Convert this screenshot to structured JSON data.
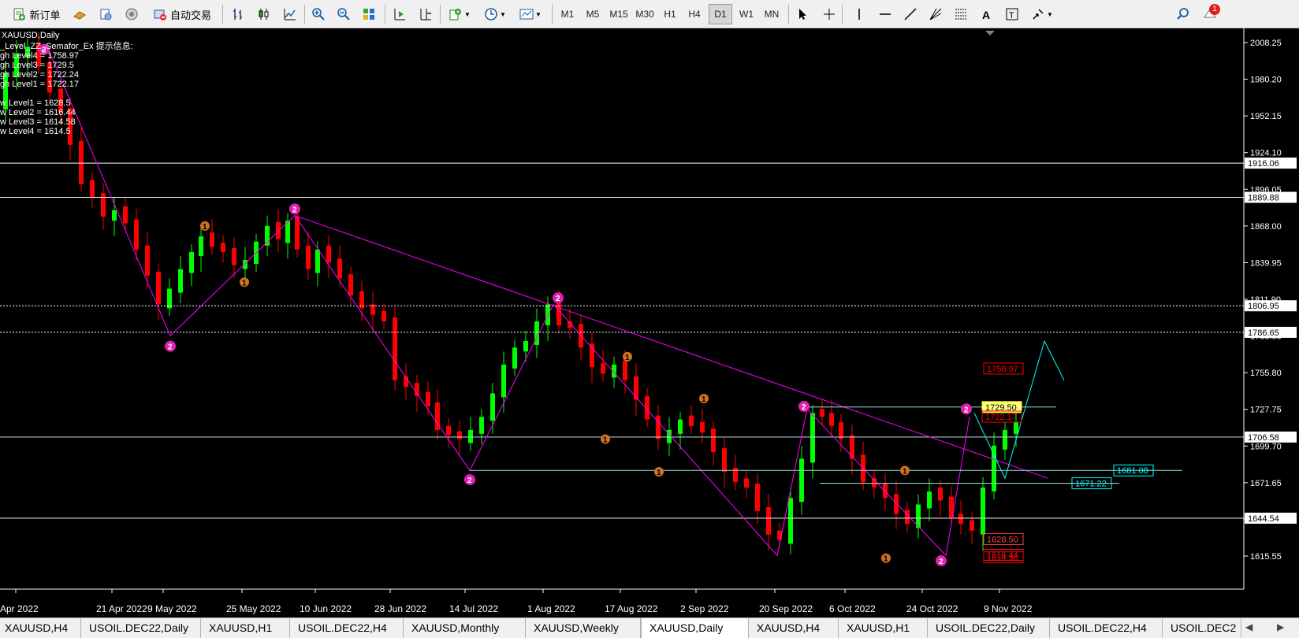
{
  "toolbar": {
    "new_order_label": "新订单",
    "autotrade_label": "自动交易",
    "timeframes": [
      "M1",
      "M5",
      "M15",
      "M30",
      "H1",
      "H4",
      "D1",
      "W1",
      "MN"
    ],
    "active_timeframe": "D1",
    "notification_count": "1",
    "icons": [
      "new-order-icon",
      "market-watch-icon",
      "data-window-icon",
      "navigator-icon",
      "autotrade-icon",
      "bar-chart-icon",
      "candlestick-icon",
      "line-chart-icon",
      "zoom-in-icon",
      "zoom-out-icon",
      "tile-windows-icon",
      "scroll-icon",
      "autoscroll-icon",
      "indicators-icon",
      "periods-icon",
      "templates-icon",
      "cursor-icon",
      "crosshair-icon",
      "vertical-line-icon",
      "horizontal-line-icon",
      "trendline-icon",
      "gann-icon",
      "fibonacci-icon",
      "text-icon",
      "text-label-icon",
      "arrows-icon",
      "search-icon",
      "notification-icon"
    ]
  },
  "chart": {
    "symbol_label": "XAUUSD,Daily",
    "info_lines": [
      "_Level_ZZ_Semafor_Ex 提示信息:",
      "gh Level4 = 1758.97",
      "gh Level3 = 1729.5",
      "gh Level2 = 1722.24",
      "gh Level1 = 1722.17",
      "",
      "w Level1 = 1628.5",
      "w Level2 = 1616.44",
      "w Level3 = 1614.58",
      "w Level4 = 1614.5"
    ],
    "colors": {
      "background": "#000000",
      "bull": "#00ff00",
      "bear": "#ff0000",
      "zigzag": "#ff00ff",
      "forecast": "#00ffff",
      "grid_text": "#ffffff"
    },
    "price_ticks": [
      "2008.25",
      "1980.20",
      "1952.15",
      "1924.10",
      "1896.05",
      "1868.00",
      "1839.95",
      "1811.90",
      "1783.85",
      "1755.80",
      "1727.75",
      "1699.70",
      "1671.65",
      "1643.60",
      "1615.55"
    ],
    "date_ticks": [
      "Apr 2022",
      "21 Apr 2022",
      "9 May 2022",
      "25 May 2022",
      "10 Jun 2022",
      "28 Jun 2022",
      "14 Jul 2022",
      "1 Aug 2022",
      "17 Aug 2022",
      "2 Sep 2022",
      "20 Sep 2022",
      "6 Oct 2022",
      "24 Oct 2022",
      "9 Nov 2022"
    ],
    "horizontal_levels": [
      {
        "label": "1916.06",
        "style": "solid",
        "color": "#ffffff"
      },
      {
        "label": "1889.88",
        "style": "solid",
        "color": "#ffffff"
      },
      {
        "label": "1806.95",
        "style": "dotted",
        "color": "#ffffff"
      },
      {
        "label": "1786.65",
        "style": "dotted",
        "color": "#ffffff"
      },
      {
        "label": "1706.58",
        "style": "solid",
        "color": "#c0e8e8"
      },
      {
        "label": "1644.54",
        "style": "solid",
        "color": "#ffffff"
      }
    ],
    "semafor_labels": [
      {
        "label": "1758.97",
        "color": "#ff0000"
      },
      {
        "label": "1729.50",
        "color": "#ffff00"
      },
      {
        "label": "1722.17",
        "color": "#ff0000"
      },
      {
        "label": "1681.08",
        "color": "#00ffff"
      },
      {
        "label": "1671.22",
        "color": "#00ffff"
      },
      {
        "label": "1628.50",
        "color": "#ff4040"
      },
      {
        "label": "1616.44",
        "color": "#ff0000"
      },
      {
        "label": "1614.58",
        "color": "#ff0000"
      }
    ],
    "markers": [
      {
        "text": "2",
        "kind": "major"
      },
      {
        "text": "2",
        "kind": "major"
      },
      {
        "text": "2",
        "kind": "major"
      },
      {
        "text": "2",
        "kind": "major"
      },
      {
        "text": "2",
        "kind": "major"
      },
      {
        "text": "2",
        "kind": "major"
      },
      {
        "text": "2",
        "kind": "major"
      },
      {
        "text": "2",
        "kind": "major"
      },
      {
        "text": "1",
        "kind": "minor"
      },
      {
        "text": "1",
        "kind": "minor"
      },
      {
        "text": "1",
        "kind": "minor"
      },
      {
        "text": "1",
        "kind": "minor"
      },
      {
        "text": "1",
        "kind": "minor"
      },
      {
        "text": "1",
        "kind": "minor"
      },
      {
        "text": "1",
        "kind": "minor"
      },
      {
        "text": "1",
        "kind": "minor"
      }
    ]
  },
  "tabs": [
    "XAUUSD,H4",
    "USOIL.DEC22,Daily",
    "XAUUSD,H1",
    "USOIL.DEC22,H4",
    "XAUUSD,Monthly",
    "XAUUSD,Weekly",
    "XAUUSD,Daily",
    "XAUUSD,H4",
    "XAUUSD,H1",
    "USOIL.DEC22,Daily",
    "USOIL.DEC22,H4",
    "USOIL.DEC2"
  ],
  "active_tab": "XAUUSD,Daily"
}
